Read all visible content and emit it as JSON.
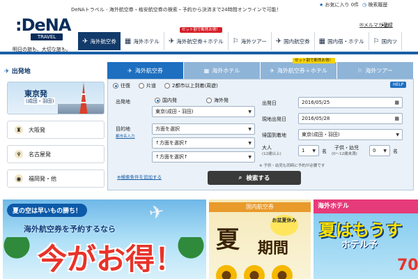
{
  "header": {
    "logo_brand": ":DeNA",
    "logo_sub": "TRAVEL",
    "tagline": "明日の旅も、大切な旅も。",
    "description": "DeNAトラベル - 海外航空券・格安航空券の検索・予約から決済まで24時間オンラインで可能！",
    "favorites": "お気に入り 0件",
    "history": "検索履歴",
    "link_mailmag": "メルマガ登録",
    "link_other": "お"
  },
  "nav": {
    "items": [
      {
        "label": "海外航空券",
        "icon": "plane-icon"
      },
      {
        "label": "海外ホテル",
        "icon": "hotel-icon"
      },
      {
        "label": "海外航空券＋ホテル",
        "icon": "plane-hotel-icon",
        "badge": "セット割で断然お得！"
      },
      {
        "label": "海外ツアー",
        "icon": "tour-icon"
      },
      {
        "label": "国内航空券",
        "icon": "plane-icon"
      },
      {
        "label": "国内宿・ホテル",
        "icon": "hotel-icon"
      },
      {
        "label": "国内ツ",
        "icon": "tour-icon"
      }
    ]
  },
  "sidebar": {
    "title": "出発地",
    "tokyo_main": "東京発",
    "tokyo_sub": "(成田・羽田)",
    "items": [
      {
        "label": "大阪発",
        "icon": "osaka-castle-icon"
      },
      {
        "label": "名古屋発",
        "icon": "nagoya-shachi-icon"
      },
      {
        "label": "福岡発・他",
        "icon": "eye-icon"
      }
    ]
  },
  "search": {
    "tabs": [
      {
        "label": "海外航空券"
      },
      {
        "label": "海外ホテル"
      },
      {
        "label": "海外航空券＋ホテル",
        "badge": "セット割で断然お得！"
      },
      {
        "label": "海外ツアー"
      }
    ],
    "trip_types": [
      "往復",
      "片道",
      "2都市以上到着(周遊)"
    ],
    "trip_type_selected": 0,
    "help": "HELP",
    "departure_label": "出発地",
    "departure_scope": [
      "国内発",
      "海外発"
    ],
    "departure_scope_selected": 0,
    "departure_value": "東京(成田・羽田)",
    "destination_label": "目的地",
    "destination_sublink": "都市名入力",
    "destination_values": [
      "方面を選択",
      "↑方面を選択↑",
      "↑方面を選択↑"
    ],
    "depart_date_label": "出発日",
    "depart_date": "2016/05/25",
    "local_depart_label": "現地出発日",
    "local_depart_date": "2016/05/28",
    "return_arrival_label": "帰国到着地",
    "return_arrival_value": "東京(成田・羽田)",
    "adults_label": "大人",
    "adults_sub": "(12歳以上)",
    "adults_value": "1",
    "adults_unit": "名",
    "children_label": "子供・幼児",
    "children_sub": "(0〜12歳未満)",
    "children_value": "0",
    "children_unit": "名",
    "note": "※ 子供・幼児も同時に予約が必要です",
    "add_condition": "検索条件を追加する",
    "search_button": "検索する"
  },
  "banners": {
    "b1_ribbon": "夏の空は早いもの勝ち！",
    "b1_line": "海外航空券を予約するなら",
    "b1_big": "今がお得！",
    "b2_header": "国内航空券",
    "b2_badge": "お盆夏休み",
    "b2_natsu": "夏",
    "b2_kikan": "期間",
    "b3_header": "海外ホテル",
    "b3_t1": "夏はもうす",
    "b3_t2": "ホテル予",
    "b3_t3": "70"
  }
}
